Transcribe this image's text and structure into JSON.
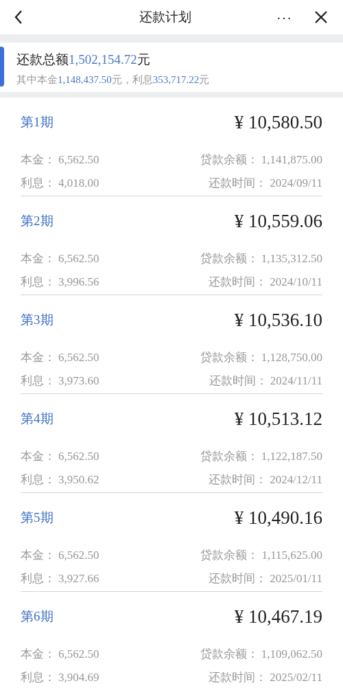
{
  "header": {
    "title": "还款计划",
    "more": "···"
  },
  "summary": {
    "total_label": "还款总额",
    "total": "1,502,154.72",
    "total_unit": "元",
    "principal_label": "其中本金",
    "principal": "1,148,437.50",
    "mid": "元，利息",
    "interest": "353,717.22",
    "unit": "元"
  },
  "periods": [
    {
      "period": "第1期",
      "amount": "¥ 10,580.50",
      "principal_label": "本金：",
      "principal": "6,562.50",
      "balance_label": "贷款余额：",
      "balance": "1,141,875.00",
      "interest_label": "利息：",
      "interest": "4,018.00",
      "date_label": "还款时间：",
      "date": "2024/09/11"
    },
    {
      "period": "第2期",
      "amount": "¥ 10,559.06",
      "principal_label": "本金：",
      "principal": "6,562.50",
      "balance_label": "贷款余额：",
      "balance": "1,135,312.50",
      "interest_label": "利息：",
      "interest": "3,996.56",
      "date_label": "还款时间：",
      "date": "2024/10/11"
    },
    {
      "period": "第3期",
      "amount": "¥ 10,536.10",
      "principal_label": "本金：",
      "principal": "6,562.50",
      "balance_label": "贷款余额：",
      "balance": "1,128,750.00",
      "interest_label": "利息：",
      "interest": "3,973.60",
      "date_label": "还款时间：",
      "date": "2024/11/11"
    },
    {
      "period": "第4期",
      "amount": "¥ 10,513.12",
      "principal_label": "本金：",
      "principal": "6,562.50",
      "balance_label": "贷款余额：",
      "balance": "1,122,187.50",
      "interest_label": "利息：",
      "interest": "3,950.62",
      "date_label": "还款时间：",
      "date": "2024/12/11"
    },
    {
      "period": "第5期",
      "amount": "¥ 10,490.16",
      "principal_label": "本金：",
      "principal": "6,562.50",
      "balance_label": "贷款余额：",
      "balance": "1,115,625.00",
      "interest_label": "利息：",
      "interest": "3,927.66",
      "date_label": "还款时间：",
      "date": "2025/01/11"
    },
    {
      "period": "第6期",
      "amount": "¥ 10,467.19",
      "principal_label": "本金：",
      "principal": "6,562.50",
      "balance_label": "贷款余额：",
      "balance": "1,109,062.50",
      "interest_label": "利息：",
      "interest": "3,904.69",
      "date_label": "还款时间：",
      "date": "2025/02/11"
    }
  ]
}
